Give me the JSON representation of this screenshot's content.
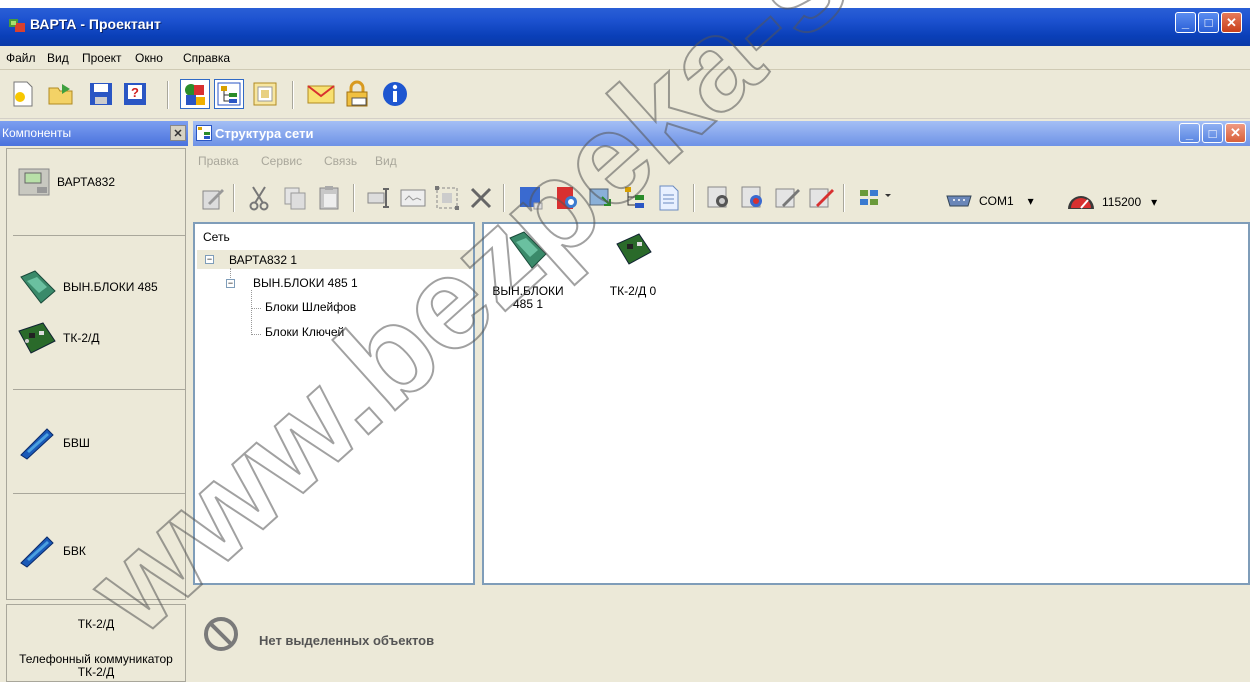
{
  "app": {
    "title": "ВАРТА - Проектант",
    "window_buttons": [
      "minimize",
      "maximize",
      "close"
    ]
  },
  "menubar": {
    "items": [
      "Файл",
      "Вид",
      "Проект",
      "Окно",
      "Справка"
    ]
  },
  "toolbar": {
    "icons": [
      "new-project-icon",
      "open-project-icon",
      "save-icon",
      "help-icon",
      "components-icon",
      "network-structure-icon",
      "properties-icon",
      "mail-icon",
      "lock-icon",
      "info-icon"
    ]
  },
  "components_panel": {
    "title": "Компоненты",
    "items": [
      {
        "label": "ВАРТА832",
        "icon": "controller-icon"
      },
      {
        "label": "ВЫН.БЛОКИ 485",
        "icon": "remote-block-icon"
      },
      {
        "label": "ТК-2/Д",
        "icon": "board-icon"
      },
      {
        "label": "БВШ",
        "icon": "loop-block-icon"
      },
      {
        "label": "БВК",
        "icon": "key-block-icon"
      }
    ],
    "info": {
      "name": "ТК-2/Д",
      "description": "Телефонный коммуникатор ТК-2/Д"
    }
  },
  "network_window": {
    "title": "Структура сети",
    "menu": [
      "Правка",
      "Сервис",
      "Связь",
      "Вид"
    ],
    "port": "COM1",
    "baud": "115200",
    "tree": {
      "root": "Сеть",
      "nodes": [
        {
          "label": "ВАРТА832 1",
          "level": 1,
          "selected": true
        },
        {
          "label": "ВЫН.БЛОКИ 485 1",
          "level": 2
        },
        {
          "label": "Блоки Шлейфов",
          "level": 3
        },
        {
          "label": "Блоки Ключей",
          "level": 3
        }
      ]
    },
    "canvas_devices": [
      {
        "label_line1": "ВЫН.БЛОКИ",
        "label_line2": "485 1"
      },
      {
        "label_line1": "ТК-2/Д 0",
        "label_line2": ""
      }
    ]
  },
  "status": {
    "text": "Нет выделенных объектов"
  },
  "watermark": "www.bezpeka-s"
}
